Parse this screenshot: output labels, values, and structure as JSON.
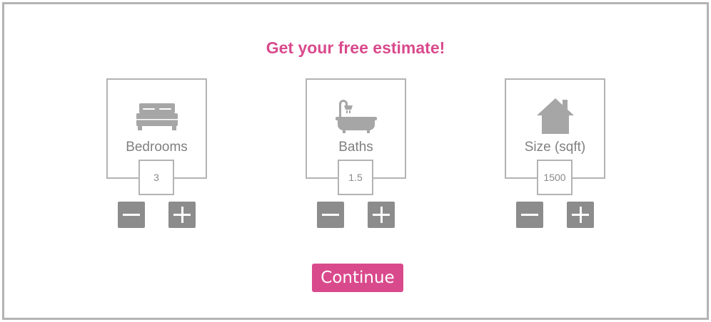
{
  "heading": "Get your free estimate!",
  "fields": [
    {
      "label": "Bedrooms",
      "value": "3",
      "icon": "bed-icon"
    },
    {
      "label": "Baths",
      "value": "1.5",
      "icon": "bathtub-icon"
    },
    {
      "label": "Size (sqft)",
      "value": "1500",
      "icon": "house-icon"
    }
  ],
  "continue_label": "Continue",
  "colors": {
    "accent": "#d94a8c",
    "border": "#b3b3b3",
    "icon": "#a6a6a6",
    "button": "#8c8c8c",
    "text": "#808080"
  }
}
